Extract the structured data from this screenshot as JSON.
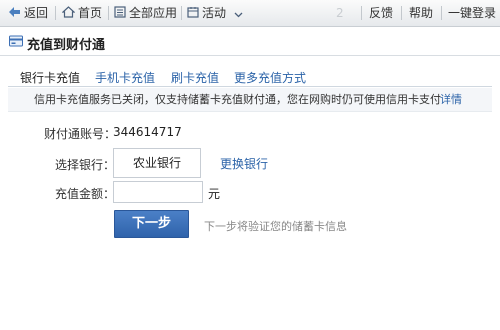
{
  "toolbar": {
    "back_label": "返回",
    "home_label": "首页",
    "all_apps_label": "全部应用",
    "activity_label": "活动",
    "faded_digit": "2",
    "feedback_label": "反馈",
    "help_label": "帮助",
    "one_click_label": "一键登录",
    "icons": [
      "back-arrow-icon",
      "home-icon",
      "apps-icon",
      "calendar-icon",
      "chevron-down-icon"
    ]
  },
  "page": {
    "title": "充值到财付通",
    "title_icon": "card-icon"
  },
  "tabs": [
    {
      "label": "银行卡充值",
      "active": true
    },
    {
      "label": "手机卡充值",
      "active": false
    },
    {
      "label": "刷卡充值",
      "active": false
    },
    {
      "label": "更多充值方式",
      "active": false
    }
  ],
  "notice": {
    "message": "信用卡充值服务已关闭，仅支持储蓄卡充值财付通，您在网购时仍可使用信用卡支付",
    "details_link": "详情"
  },
  "form": {
    "account_label": "财付通账号：",
    "account_value": "344614717",
    "bank_label": "选择银行：",
    "bank_value": "农业银行",
    "change_bank_link": "更换银行",
    "amount_label": "充值金额：",
    "amount_value": "",
    "amount_unit": "元",
    "next_button": "下一步",
    "next_hint": "下一步将验证您的储蓄卡信息"
  },
  "colors": {
    "link": "#2b63a8",
    "button": "#3a6fb8"
  }
}
